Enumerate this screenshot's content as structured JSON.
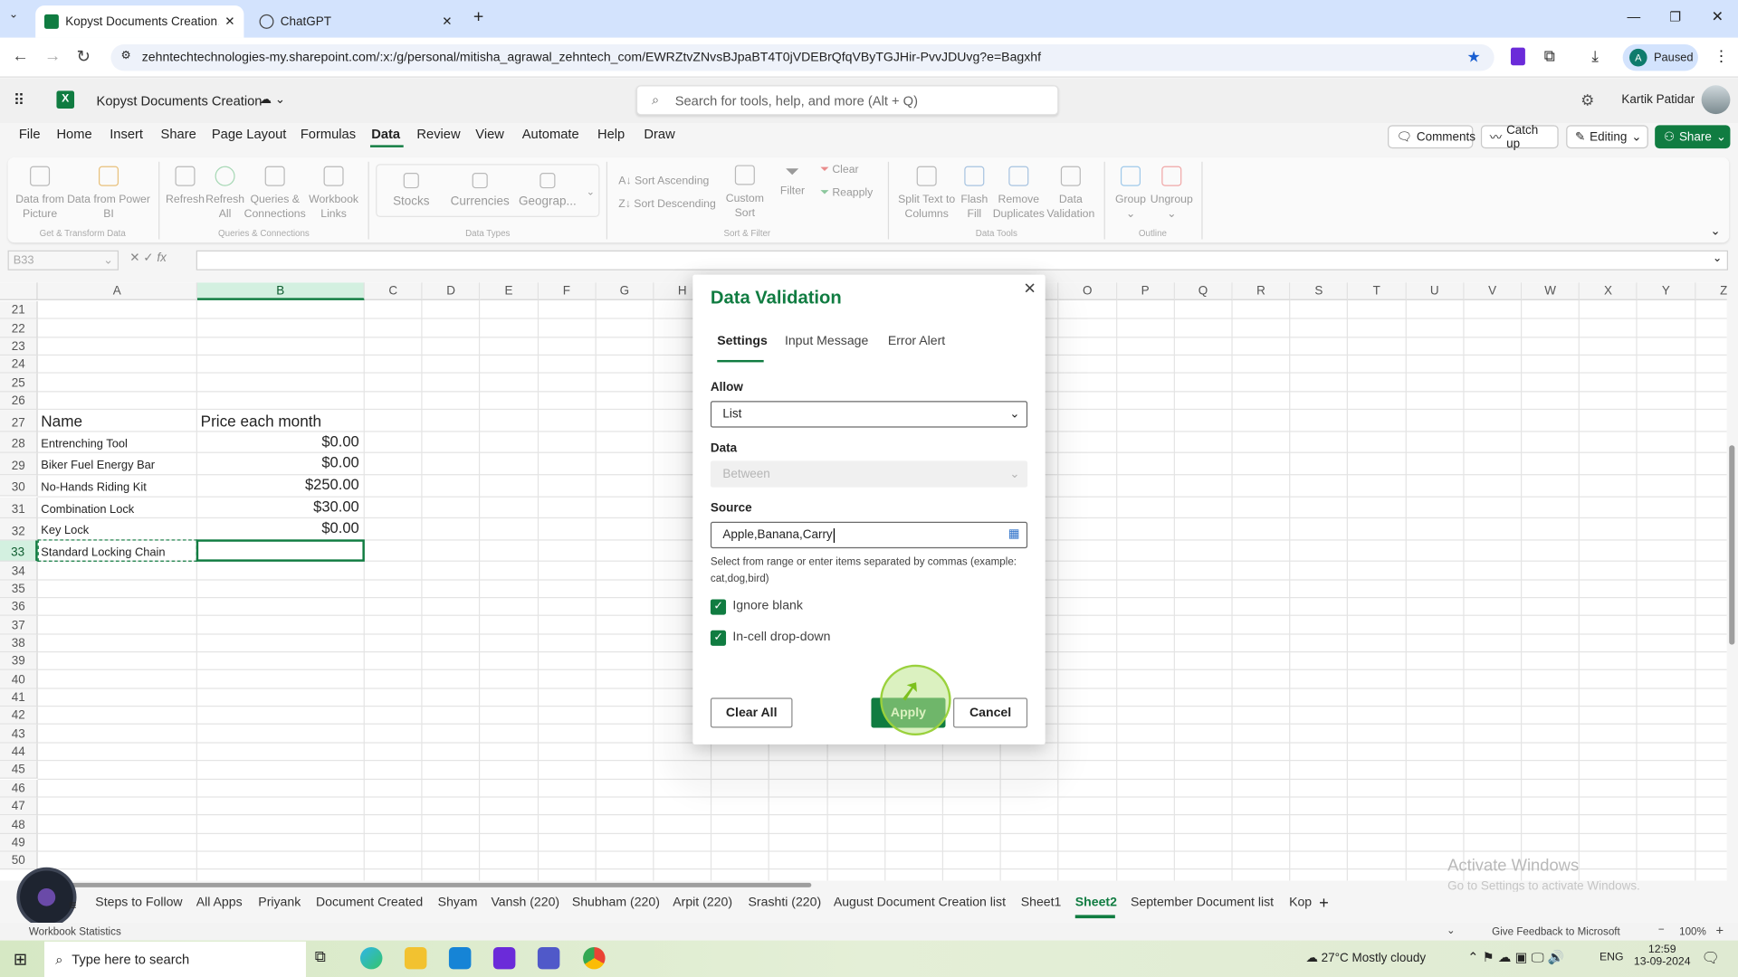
{
  "browser": {
    "tabs": [
      {
        "title": "Kopyst Documents Creation.xlsx",
        "active": true
      },
      {
        "title": "ChatGPT",
        "active": false
      }
    ],
    "url": "zehntechtechnologies-my.sharepoint.com/:x:/g/personal/mitisha_agrawal_zehntech_com/EWRZtvZNvsBJpaBT4T0jVDEBrQfqVByTGJHir-PvvJDUvg?e=Bagxhf",
    "profile_label": "Paused",
    "profile_initial": "A"
  },
  "excel": {
    "doc_title": "Kopyst Documents Creation",
    "search_placeholder": "Search for tools, help, and more (Alt + Q)",
    "user_name": "Kartik Patidar",
    "menu": [
      "File",
      "Home",
      "Insert",
      "Share",
      "Page Layout",
      "Formulas",
      "Data",
      "Review",
      "View",
      "Automate",
      "Help",
      "Draw"
    ],
    "active_menu": "Data",
    "header_buttons": {
      "comments": "Comments",
      "catch_up": "Catch up",
      "editing": "Editing",
      "share": "Share"
    },
    "ribbon": {
      "groups": [
        "Get & Transform Data",
        "Queries & Connections",
        "Data Types",
        "Sort & Filter",
        "Data Tools",
        "Outline"
      ],
      "get_transform": [
        {
          "l1": "Data from",
          "l2": "Picture"
        },
        {
          "l1": "Data from Power",
          "l2": "BI"
        }
      ],
      "queries": [
        {
          "l1": "Refresh",
          "l2": ""
        },
        {
          "l1": "Refresh",
          "l2": "All"
        },
        {
          "l1": "Queries &",
          "l2": "Connections"
        },
        {
          "l1": "Workbook",
          "l2": "Links"
        }
      ],
      "data_types": [
        "Stocks",
        "Currencies",
        "Geograp..."
      ],
      "sort_asc": "Sort Ascending",
      "sort_desc": "Sort Descending",
      "custom_sort": {
        "l1": "Custom",
        "l2": "Sort"
      },
      "filter": "Filter",
      "clear": "Clear",
      "reapply": "Reapply",
      "data_tools": [
        {
          "l1": "Split Text to",
          "l2": "Columns"
        },
        {
          "l1": "Flash",
          "l2": "Fill"
        },
        {
          "l1": "Remove",
          "l2": "Duplicates"
        },
        {
          "l1": "Data",
          "l2": "Validation"
        }
      ],
      "outline": [
        "Group",
        "Ungroup"
      ]
    },
    "name_box": "B33",
    "columns": [
      "A",
      "B",
      "C",
      "D",
      "E",
      "F",
      "G",
      "H",
      "I",
      "J",
      "K",
      "L",
      "M",
      "N",
      "O",
      "P",
      "Q",
      "R",
      "S",
      "T",
      "U",
      "V",
      "W",
      "X",
      "Y",
      "Z"
    ],
    "selected_column": "B",
    "rows": [
      21,
      22,
      23,
      24,
      25,
      26,
      27,
      28,
      29,
      30,
      31,
      32,
      33,
      34,
      35,
      36,
      37,
      38,
      39,
      40,
      41,
      42,
      43,
      44,
      45,
      46,
      47,
      48,
      49,
      50
    ],
    "selected_row": 33,
    "table": {
      "headers": [
        "Name",
        "Price each month"
      ],
      "rows": [
        {
          "name": "Entrenching Tool",
          "price": "$0.00"
        },
        {
          "name": "Biker Fuel Energy Bar",
          "price": "$0.00"
        },
        {
          "name": "No-Hands Riding Kit",
          "price": "$250.00"
        },
        {
          "name": "Combination Lock",
          "price": "$30.00"
        },
        {
          "name": "Key Lock",
          "price": "$0.00"
        },
        {
          "name": "Standard Locking Chain",
          "price": ""
        }
      ]
    },
    "sheet_tabs": [
      "Steps to Follow",
      "All Apps",
      "Priyank",
      "Document Created",
      "Shyam",
      "Vansh (220)",
      "Shubham (220)",
      "Arpit (220)",
      "Srashti (220)",
      "August Document Creation list",
      "Sheet1",
      "Sheet2",
      "September Document list",
      "Kop"
    ],
    "active_sheet": "Sheet2",
    "status": {
      "left": "Workbook Statistics",
      "feedback": "Give Feedback to Microsoft",
      "zoom": "100%"
    },
    "watermark": {
      "line1": "Activate Windows",
      "line2": "Go to Settings to activate Windows."
    }
  },
  "dialog": {
    "title": "Data Validation",
    "tabs": [
      "Settings",
      "Input Message",
      "Error Alert"
    ],
    "active_tab": "Settings",
    "allow_label": "Allow",
    "allow_value": "List",
    "data_label": "Data",
    "data_value": "Between",
    "source_label": "Source",
    "source_value": "Apple,Banana,Carry",
    "hint": "Select from range or enter items separated by commas (example: cat,dog,bird)",
    "ignore_blank": {
      "label": "Ignore blank",
      "checked": true
    },
    "in_cell_dropdown": {
      "label": "In-cell drop-down",
      "checked": true
    },
    "buttons": {
      "clear_all": "Clear All",
      "apply": "Apply",
      "cancel": "Cancel"
    }
  },
  "taskbar": {
    "search_placeholder": "Type here to search",
    "weather": "27°C  Mostly cloudy",
    "language": "ENG",
    "time": "12:59",
    "date": "13-09-2024"
  },
  "colors": {
    "excel_green": "#107c41",
    "chrome_tab_bar": "#d3e3fd",
    "cursor_highlight": "#9ad13c"
  }
}
